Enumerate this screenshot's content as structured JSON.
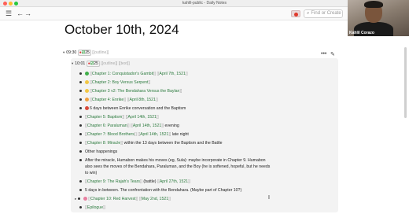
{
  "window": {
    "title": "kahlil-public - Daily Notes",
    "traffic_colors": [
      "#ff5f57",
      "#febc2e",
      "#28c840"
    ]
  },
  "toolbar": {
    "search_placeholder": "Find or Create"
  },
  "webcam": {
    "name": "Kahlil Corazo"
  },
  "page": {
    "title": "October 10th, 2024"
  },
  "outline": {
    "time": "09:30",
    "badge_red": "⬤",
    "badge_check": "✅",
    "badge_count": "25",
    "tag": "[[outline]]"
  },
  "entry": {
    "time": "10:01",
    "badge_count": "25",
    "tags": "[[outline]] [[text]]"
  },
  "items": [
    {
      "emoji": "green",
      "ref": "Chapter 1: Conquistador's Gambit",
      "date": "April 7th, 1521",
      "suffix": ""
    },
    {
      "emoji": "yellow",
      "ref": "Chapter 2: Boy Versus Serpent",
      "date": "",
      "suffix": ""
    },
    {
      "emoji": "yellow",
      "ref": "Chapter 3 v2: The Bendahara Versus the Baylan",
      "date": "",
      "suffix": ""
    },
    {
      "emoji": "orange",
      "ref": "Chapter 4: Enrike",
      "date": "April 8th, 1521",
      "suffix": ""
    },
    {
      "emoji": "",
      "ref": "",
      "date": "",
      "suffix": "6 days between Enrike conversation and the Baptism"
    },
    {
      "emoji": "",
      "ref": "Chapter 5: Baptism",
      "date": "April 14th, 1521",
      "suffix": ""
    },
    {
      "emoji": "",
      "ref": "Chapter 6: Paraluman",
      "date": "April 14th, 1521",
      "suffix": " evening"
    },
    {
      "emoji": "",
      "ref": "Chapter 7: Blood Brothers",
      "date": "April 14th, 1521",
      "suffix": " late night"
    },
    {
      "emoji": "",
      "ref": "Chapter 8: Miracle",
      "date": "",
      "suffix": " within the 13 days between the Baptism and the Battle"
    },
    {
      "emoji": "",
      "ref": "",
      "date": "",
      "suffix": "Other happenings"
    }
  ],
  "paragraph": {
    "line1": "After the miracle, Humabon makes his moves (eg, Sula): maybe incorporate in Chapter 9. Humabon",
    "line2": "also sees the moves of the Bendahara, Paraluman, and the Boy (he is softened, hopeful, but he needs",
    "line3": "to win)"
  },
  "items2": [
    {
      "ref": "Chapter 9: The Rajah's Tears",
      "mid": " (battle) ",
      "date": "April 27th, 1521"
    },
    {
      "plain": "5 days in between. The confrontation with the Bendahara. (Maybe part of Chapter 10?)"
    },
    {
      "ref": "Chapter 10: Red Harvest",
      "mid": " ",
      "date": "May 2nd, 1521"
    },
    {
      "ref": "Epilogue"
    }
  ]
}
